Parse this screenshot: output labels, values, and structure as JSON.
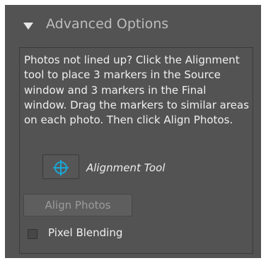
{
  "header": {
    "icon": "disclosure-triangle-down-icon",
    "title": "Advanced Options"
  },
  "panel": {
    "description": "Photos not lined up? Click the Alignment tool to place 3 markers in the Source window and 3 markers in the Final window. Drag the markers to similar areas on each photo. Then click Align Photos.",
    "alignment_tool": {
      "icon": "crosshair-target-icon",
      "label": "Alignment Tool"
    },
    "align_photos_button": {
      "label": "Align Photos",
      "enabled": false
    },
    "pixel_blending": {
      "label": "Pixel Blending",
      "checked": false
    }
  },
  "colors": {
    "panel_background": "#535353",
    "header_text": "#bdbdbd",
    "body_text": "#f0f0f0",
    "disabled_text": "#9c9c9c",
    "icon_accent": "#1aa7d6"
  }
}
